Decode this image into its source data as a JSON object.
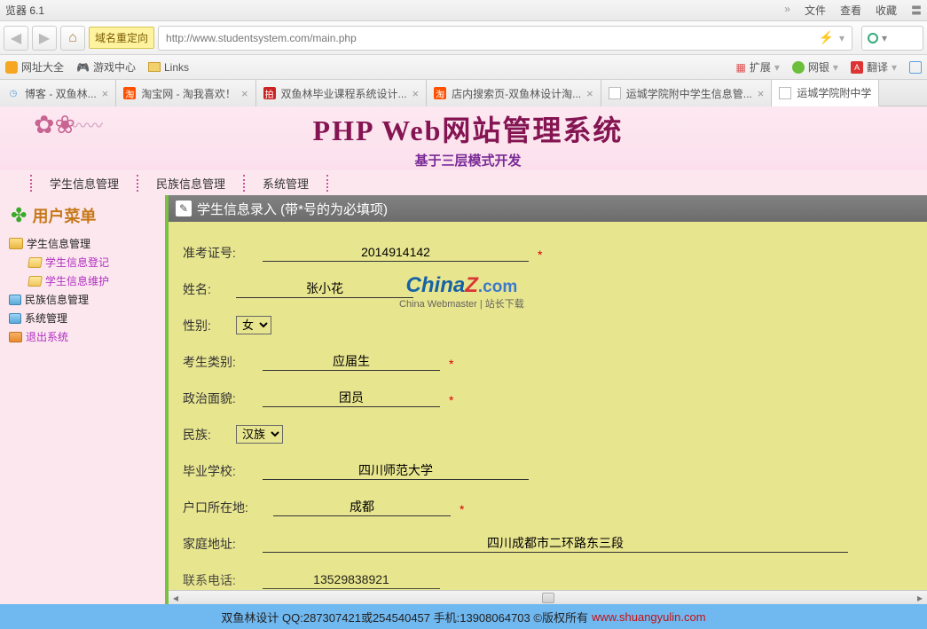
{
  "browser": {
    "title_fragment": "览器 6.1",
    "menu": {
      "file": "文件",
      "view": "查看",
      "favorites": "收藏"
    },
    "url_tag": "域名重定向",
    "url": "http://www.studentsystem.com/main.php",
    "bookmarks": {
      "site_all": "网址大全",
      "game_center": "游戏中心",
      "links": "Links",
      "ext": "扩展",
      "bank": "网银",
      "translate": "翻译"
    },
    "tabs": [
      {
        "title": "博客 - 双鱼林...",
        "icon": "clock"
      },
      {
        "title": "淘宝网 - 淘我喜欢！",
        "icon": "tb"
      },
      {
        "title": "双鱼林毕业课程系统设计...",
        "icon": "red"
      },
      {
        "title": "店内搜索页-双鱼林设计淘...",
        "icon": "tb"
      },
      {
        "title": "运城学院附中学生信息管...",
        "icon": "doc"
      },
      {
        "title": "运城学院附中学",
        "icon": "doc",
        "active": true,
        "noclose": true
      }
    ]
  },
  "banner": {
    "title": "PHP Web网站管理系统",
    "subtitle": "基于三层模式开发"
  },
  "topmenu": [
    "学生信息管理",
    "民族信息管理",
    "系统管理"
  ],
  "sidebar": {
    "header": "用户菜单",
    "tree": {
      "n1": "学生信息管理",
      "n1a": "学生信息登记",
      "n1b": "学生信息维护",
      "n2": "民族信息管理",
      "n3": "系统管理",
      "n4": "退出系统"
    }
  },
  "form": {
    "header": "学生信息录入 (带*号的为必填项)",
    "labels": {
      "exam_id": "准考证号:",
      "name": "姓名:",
      "gender": "性别:",
      "cand_type": "考生类别:",
      "politics": "政治面貌:",
      "ethnic": "民族:",
      "grad_school": "毕业学校:",
      "hukou": "户口所在地:",
      "address": "家庭地址:",
      "phone": "联系电话:"
    },
    "values": {
      "exam_id": "2014914142",
      "name": "张小花",
      "gender": "女",
      "cand_type": "应届生",
      "politics": "团员",
      "ethnic": "汉族",
      "grad_school": "四川师范大学",
      "hukou": "成都",
      "address": "四川成都市二环路东三段",
      "phone": "13529838921"
    },
    "required_marker": "*"
  },
  "watermark": {
    "line1_parts": {
      "china": "China",
      "z": "Z",
      "dotcom": ".com"
    },
    "line2": "China Webmaster | 站长下载"
  },
  "footer": {
    "text": "双鱼林设计 QQ:287307421或254540457 手机:13908064703 ©版权所有 ",
    "link": "www.shuangyulin.com"
  }
}
